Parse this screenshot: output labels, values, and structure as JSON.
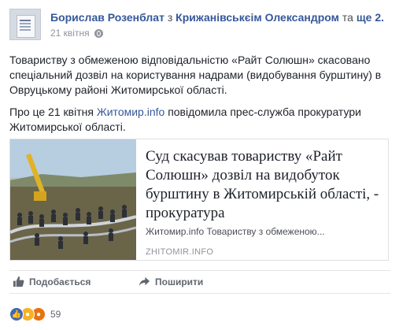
{
  "post": {
    "author": "Борислав Розенблат",
    "with_text": "з",
    "tagged": "Крижанівськєім Олександром",
    "and_text": "та",
    "others": "ще 2.",
    "date": "21 квітня",
    "paragraph1": "Товариству з обмеженою відповідальністю «Райт Солюшн» скасовано спеціальний дозвіл на користування надрами (видобування бурштину) в Овруцькому районі Житомирської області.",
    "paragraph2_before": "Про це 21 квітня",
    "paragraph2_link": "Житомир.info",
    "paragraph2_after": "повідомила прес-служба прокуратури Житомирської області."
  },
  "share": {
    "title": "Суд скасував товариству «Райт Солюшн» дозвіл на видобуток бурштину в Житомирській області, - прокуратура",
    "description": "Житомир.info Товариству з обмеженою...",
    "domain": "ZHITOMIR.INFO"
  },
  "actions": {
    "like": "Подобається",
    "share": "Поширити"
  },
  "reactions": {
    "icons": [
      "like-icon",
      "wow-icon",
      "angry-icon"
    ],
    "count": "59"
  },
  "colors": {
    "link": "#365899",
    "text": "#1d2129",
    "muted": "#90949c"
  }
}
